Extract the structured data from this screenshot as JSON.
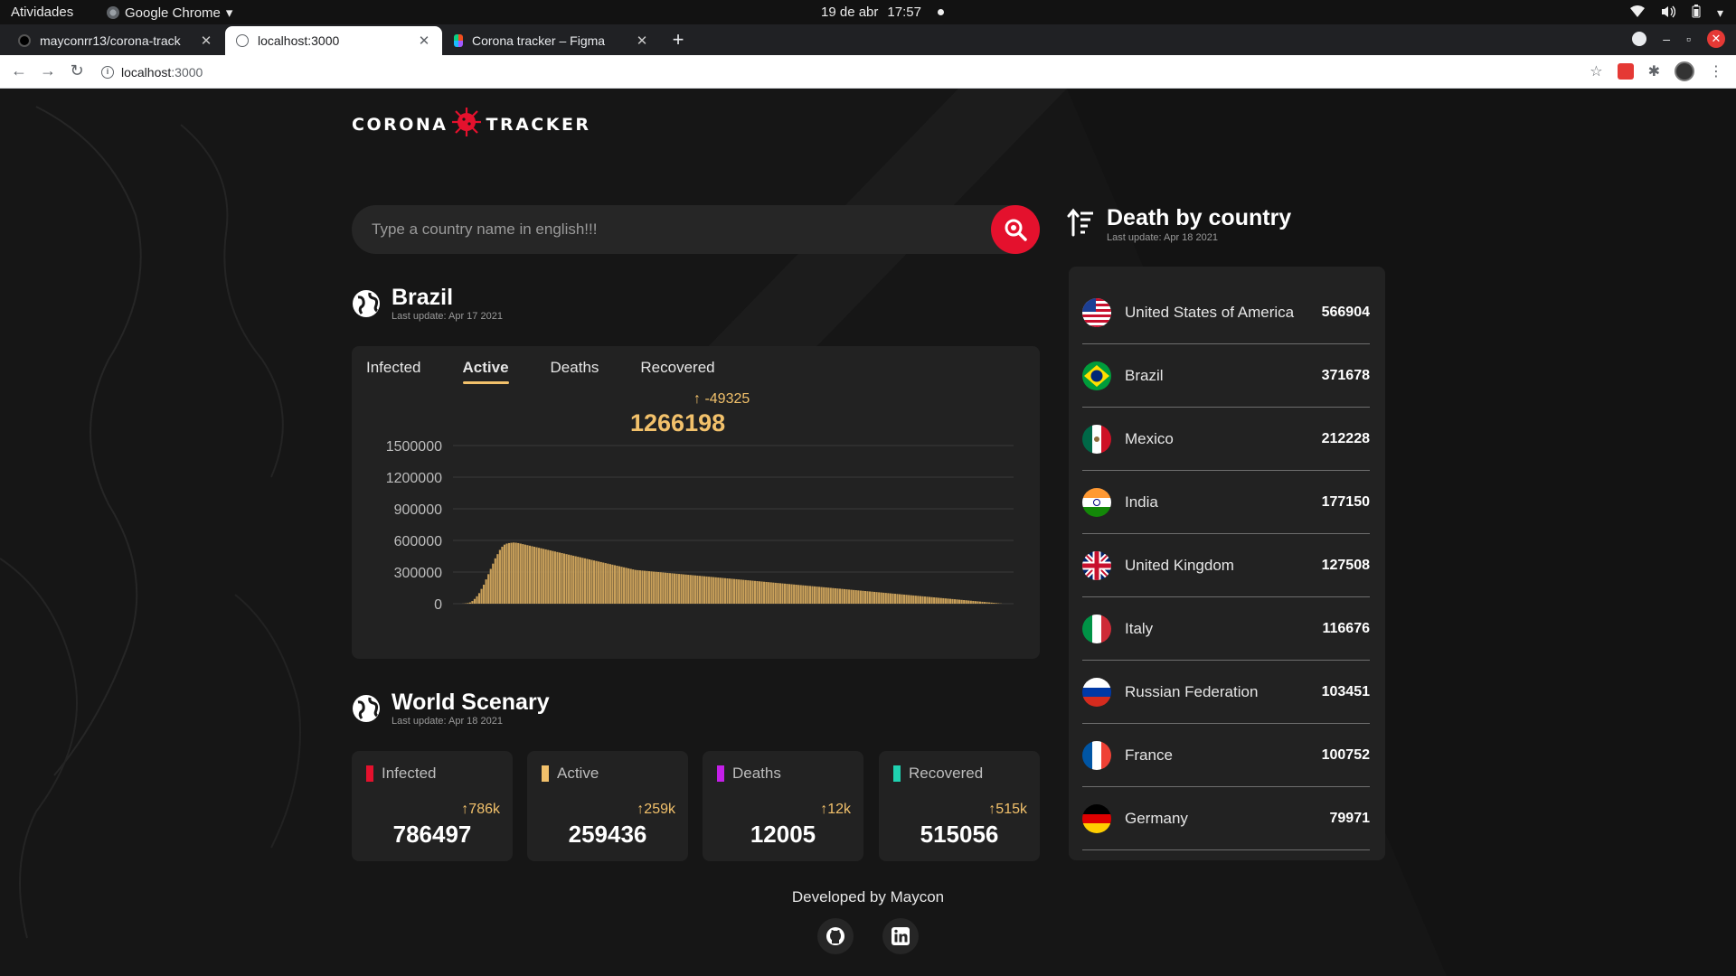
{
  "os": {
    "activities": "Atividades",
    "app_name": "Google Chrome",
    "date": "19 de abr",
    "time": "17:57"
  },
  "browser": {
    "tabs": [
      {
        "title": "mayconrr13/corona-track",
        "active": false
      },
      {
        "title": "localhost:3000",
        "active": true
      },
      {
        "title": "Corona tracker – Figma",
        "active": false
      }
    ],
    "url_host": "localhost",
    "url_port": ":3000"
  },
  "logo": {
    "left": "CORONA",
    "right": "TRACKER"
  },
  "search": {
    "placeholder": "Type a country name in english!!!"
  },
  "country": {
    "name": "Brazil",
    "last_update": "Last update: Apr 17 2021",
    "tabs": [
      "Infected",
      "Active",
      "Deaths",
      "Recovered"
    ],
    "active_tab": "Active",
    "delta": "-49325",
    "total": "1266198"
  },
  "chart_data": {
    "type": "bar",
    "title": "",
    "xlabel": "",
    "ylabel": "",
    "ylim": [
      0,
      1500000
    ],
    "yticks": [
      "1500000",
      "1200000",
      "900000",
      "600000",
      "300000",
      "0"
    ],
    "series": [
      {
        "values": [
          0,
          0,
          0,
          0,
          1000,
          3000,
          6000,
          12000,
          25000,
          45000,
          70000,
          100000,
          140000,
          180000,
          230000,
          280000,
          330000,
          380000,
          430000,
          470000,
          510000,
          540000,
          560000,
          570000,
          575000,
          578000,
          580000,
          578000,
          575000,
          570000,
          565000,
          560000,
          555000,
          550000,
          545000,
          540000,
          535000,
          530000,
          525000,
          520000,
          515000,
          510000,
          505000,
          500000,
          495000,
          490000,
          485000,
          480000,
          475000,
          470000,
          465000,
          460000,
          455000,
          450000,
          445000,
          440000,
          435000,
          430000,
          425000,
          420000,
          415000,
          410000,
          405000,
          400000,
          395000,
          390000,
          385000,
          380000,
          375000,
          370000,
          365000,
          360000,
          355000,
          350000,
          345000,
          340000,
          335000,
          330000,
          325000,
          320000,
          318000,
          316000,
          314000,
          312000,
          310000,
          308000,
          306000,
          304000,
          302000,
          300000,
          298000,
          296000,
          294000,
          292000,
          290000,
          288000,
          286000,
          284000,
          282000,
          280000,
          278000,
          276000,
          274000,
          272000,
          270000,
          268000,
          266000,
          264000,
          262000,
          260000,
          258000,
          256000,
          254000,
          252000,
          250000,
          248000,
          246000,
          244000,
          242000,
          240000,
          238000,
          236000,
          234000,
          232000,
          230000,
          228000,
          226000,
          224000,
          222000,
          220000,
          218000,
          216000,
          214000,
          212000,
          210000,
          208000,
          206000,
          204000,
          202000,
          200000,
          198000,
          196000,
          194000,
          192000,
          190000,
          188000,
          186000,
          184000,
          182000,
          180000,
          178000,
          176000,
          174000,
          172000,
          170000,
          168000,
          166000,
          164000,
          162000,
          160000,
          158000,
          156000,
          154000,
          152000,
          150000,
          148000,
          146000,
          144000,
          142000,
          140000,
          138000,
          136000,
          134000,
          132000,
          130000,
          128000,
          126000,
          124000,
          122000,
          120000,
          118000,
          116000,
          114000,
          112000,
          110000,
          108000,
          106000,
          104000,
          102000,
          100000,
          98000,
          96000,
          94000,
          92000,
          90000,
          88000,
          86000,
          84000,
          82000,
          80000,
          78000,
          76000,
          74000,
          72000,
          70000,
          68000,
          66000,
          64000,
          62000,
          60000,
          58000,
          56000,
          54000,
          52000,
          50000,
          48000,
          46000,
          44000,
          42000,
          40000,
          38000,
          36000,
          34000,
          32000,
          30000,
          28000,
          26000,
          24000,
          22000,
          20000,
          18000,
          16000,
          14000,
          12000,
          10000,
          8000,
          6000,
          4000,
          2000,
          0,
          0,
          0,
          0,
          0
        ]
      }
    ]
  },
  "world": {
    "title": "World Scenary",
    "last_update": "Last update: Apr 18 2021",
    "cards": [
      {
        "label": "Infected",
        "change": "786k",
        "value": "786497",
        "color": "#e4112d"
      },
      {
        "label": "Active",
        "change": "259k",
        "value": "259436",
        "color": "#f2c16b"
      },
      {
        "label": "Deaths",
        "change": "12k",
        "value": "12005",
        "color": "#c41fe8"
      },
      {
        "label": "Recovered",
        "change": "515k",
        "value": "515056",
        "color": "#1fd1b0"
      }
    ]
  },
  "deaths": {
    "title": "Death by country",
    "last_update": "Last update: Apr 18 2021",
    "rows": [
      {
        "name": "United States of America",
        "value": "566904",
        "flag": "usa"
      },
      {
        "name": "Brazil",
        "value": "371678",
        "flag": "brazil"
      },
      {
        "name": "Mexico",
        "value": "212228",
        "flag": "mexico"
      },
      {
        "name": "India",
        "value": "177150",
        "flag": "india"
      },
      {
        "name": "United Kingdom",
        "value": "127508",
        "flag": "uk"
      },
      {
        "name": "Italy",
        "value": "116676",
        "flag": "italy"
      },
      {
        "name": "Russian Federation",
        "value": "103451",
        "flag": "russia"
      },
      {
        "name": "France",
        "value": "100752",
        "flag": "france"
      },
      {
        "name": "Germany",
        "value": "79971",
        "flag": "germany"
      }
    ]
  },
  "footer": {
    "text": "Developed by Maycon"
  },
  "colors": {
    "accent": "#f2c16b",
    "brand_red": "#e4112d",
    "card_bg": "#222222",
    "page_bg": "#161616"
  }
}
